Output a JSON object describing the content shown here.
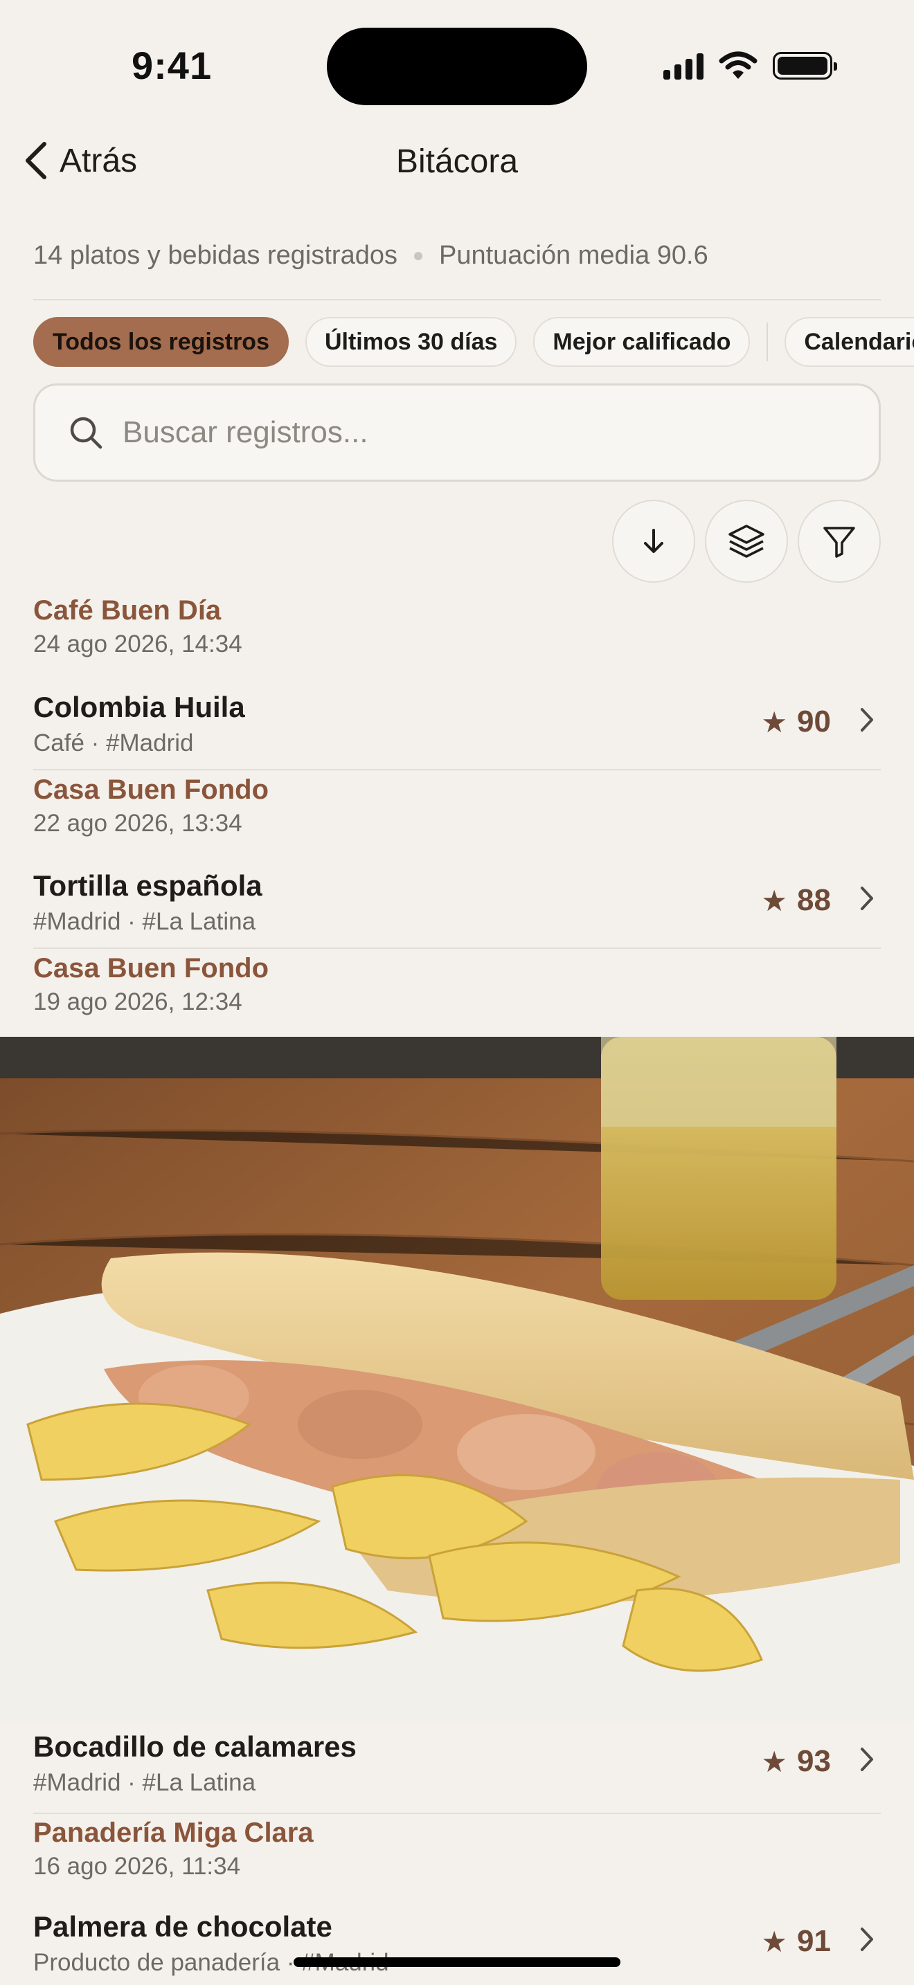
{
  "status": {
    "time": "9:41"
  },
  "nav": {
    "back_label": "Atrás",
    "title": "Bitácora"
  },
  "summary": {
    "count": "14 platos y bebidas registrados",
    "average": "Puntuación media 90.6"
  },
  "filters": [
    {
      "label": "Todos los registros",
      "active": true
    },
    {
      "label": "Últimos 30 días",
      "active": false
    },
    {
      "label": "Mejor calificado",
      "active": false
    },
    {
      "label": "Calendario",
      "active": false
    }
  ],
  "search": {
    "placeholder": "Buscar registros..."
  },
  "tools": [
    "sort-down-icon",
    "layers-icon",
    "filter-icon"
  ],
  "entries": [
    {
      "place": "Café Buen Día",
      "datetime": "24 ago 2026, 14:34",
      "title": "Colombia Huila",
      "subtitle": "Café · #Madrid",
      "score": "90"
    },
    {
      "place": "Casa Buen Fondo",
      "datetime": "22 ago 2026, 13:34",
      "title": "Tortilla española",
      "subtitle": "#Madrid · #La Latina",
      "score": "88"
    },
    {
      "place": "Casa Buen Fondo",
      "datetime": "19 ago 2026, 12:34",
      "title": "Bocadillo de calamares",
      "subtitle": "#Madrid · #La Latina",
      "score": "93"
    },
    {
      "place": "Panadería Miga Clara",
      "datetime": "16 ago 2026, 11:34",
      "title": "Palmera de chocolate",
      "subtitle": "Producto de panadería · #Madrid",
      "score": "91"
    }
  ],
  "colors": {
    "accent": "#a46d4f",
    "place_text": "#8a553b",
    "score": "#6e4a38",
    "background": "#f4f1ec"
  }
}
